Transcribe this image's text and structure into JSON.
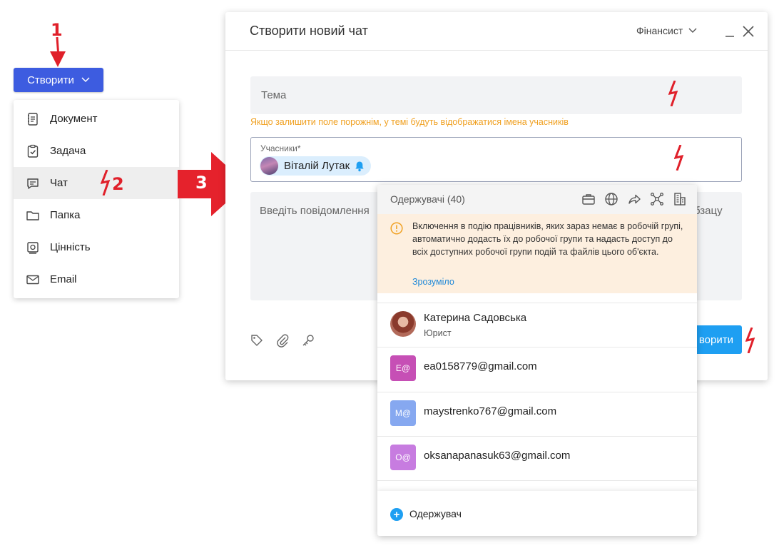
{
  "steps": {
    "one": "1",
    "two": "2",
    "three": "3"
  },
  "create_button": {
    "label": "Створити"
  },
  "menu": {
    "items": [
      {
        "label": "Документ",
        "icon": "document-icon"
      },
      {
        "label": "Задача",
        "icon": "task-icon"
      },
      {
        "label": "Чат",
        "icon": "chat-icon"
      },
      {
        "label": "Папка",
        "icon": "folder-icon"
      },
      {
        "label": "Цінність",
        "icon": "valuable-icon"
      },
      {
        "label": "Email",
        "icon": "email-icon"
      }
    ],
    "active_index": 2
  },
  "dialog": {
    "title": "Створити новий чат",
    "role": "Фінансист",
    "subject_placeholder": "Тема",
    "subject_hint": "Якщо залишити поле порожнім, у темі будуть відображатися імена учасників",
    "participants_label": "Учасники*",
    "participant_name": "Віталій Лутак",
    "message_placeholder": "Введіть повідомлення",
    "message_tail": "бзацу",
    "submit_label": "ворити"
  },
  "recipients": {
    "title": "Одержувачі (40)",
    "warning_text": "Включення в подію працівників, яких зараз немає в робочій групі, автоматично додасть їх до робочої групи та надасть доступ до всіх доступних робочої групи подій та файлів цього об'єкта.",
    "warning_link": "Зрозуміло",
    "items": [
      {
        "name": "Катерина Садовська",
        "role": "Юрист"
      },
      {
        "initials": "E@",
        "name": "ea0158779@gmail.com",
        "color": "#c64fb5"
      },
      {
        "initials": "M@",
        "name": "maystrenko767@gmail.com",
        "color": "#86a8f0"
      },
      {
        "initials": "O@",
        "name": "oksanapanasuk63@gmail.com",
        "color": "#c77ce0"
      }
    ],
    "add_label": "Одержувач"
  },
  "colors": {
    "accent": "#3d5ce0",
    "submit": "#1e9ff2",
    "marker": "#e0202a",
    "warning_bg": "#fdefdf",
    "hint": "#f0a020"
  }
}
